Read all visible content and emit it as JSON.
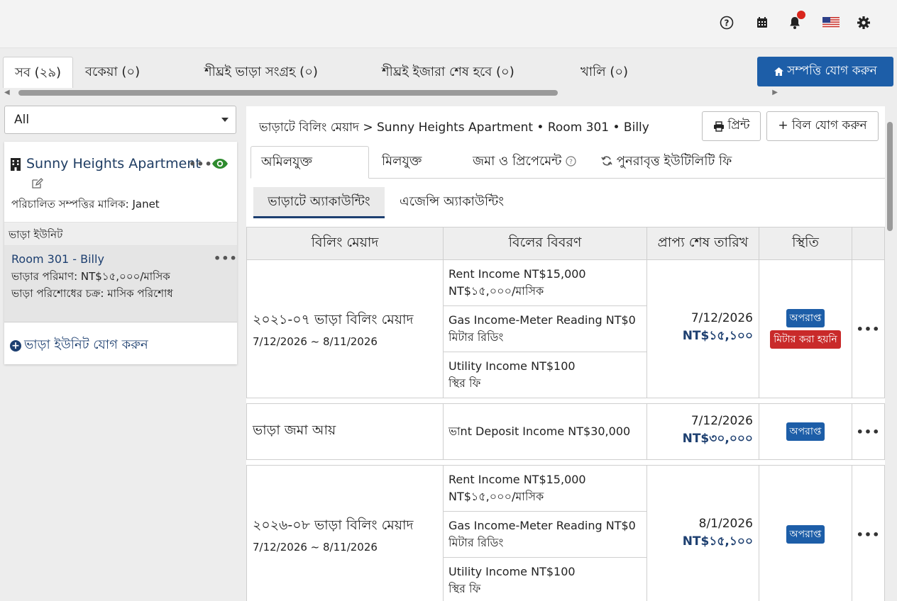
{
  "topbar": {
    "icons": [
      "help-icon",
      "calendar-icon",
      "bell-icon",
      "us-flag-icon",
      "gear-icon"
    ]
  },
  "property_tabs": [
    {
      "label": "সব (২৯)",
      "active": true
    },
    {
      "label": "বকেয়া (০)"
    },
    {
      "label": "শীঘ্রই ভাড়া সংগ্রহ (০)"
    },
    {
      "label": "শীঘ্রই ইজারা শেষ হবে (০)"
    },
    {
      "label": "খালি (০)"
    }
  ],
  "add_property_label": "সম্পত্তি যোগ করুন",
  "filter": {
    "selected": "All"
  },
  "property": {
    "name": "Sunny Heights Apartment",
    "owner": "পরিচালিত সম্পত্তির মালিক: Janet"
  },
  "rental_units_header": "ভাড়া ইউনিট",
  "unit": {
    "name": "Room 301 - Billy",
    "rent": "ভাড়ার পরিমাণ: NT$১৫,০০০/মাসিক",
    "cycle": "ভাড়া পরিশোধের চক্র: মাসিক পরিশোধ"
  },
  "add_unit_label": "ভাড়া ইউনিট যোগ করুন",
  "breadcrumb": {
    "root": "ভাড়াটে বিলিং মেয়াদ",
    "sep": ">",
    "path": "Sunny Heights Apartment • Room 301 • Billy"
  },
  "print_label": "প্রিন্ট",
  "add_bill_label": "+ বিল যোগ করুন",
  "subtabs": [
    {
      "label": "অমিলযুক্ত",
      "active": true
    },
    {
      "label": "মিলযুক্ত"
    },
    {
      "label": "জমা ও প্রিপেমেন্ট"
    },
    {
      "label": "পুনরাবৃত্ত ইউটিলিটি ফি"
    }
  ],
  "accounting_tabs": [
    {
      "label": "ভাড়াটে অ্যাকাউন্টিং",
      "active": true
    },
    {
      "label": "এজেন্সি অ্যাকাউন্টিং"
    }
  ],
  "table": {
    "headers": [
      "বিলিং মেয়াদ",
      "বিলের বিবরণ",
      "প্রাপ্য শেষ তারিখ",
      "স্থিতি",
      ""
    ],
    "groups": [
      {
        "period_title": "২০২১-০৭ ভাড়া বিলিং মেয়াদ",
        "period_dates": "7/12/2026 ~ 8/11/2026",
        "items": [
          {
            "line1": "Rent Income NT$15,000",
            "line2": "NT$১৫,০০০/মাসিক"
          },
          {
            "line1": "Gas Income-Meter Reading NT$0",
            "line2": "মিটার রিডিং"
          },
          {
            "line1": "Utility Income NT$100",
            "line2": "স্থির ফি"
          }
        ],
        "due_date": "7/12/2026",
        "due_amount": "NT$১৫,১০০",
        "badges": [
          {
            "text": "অপরাপ্ত",
            "color": "#1d5ea8"
          },
          {
            "text": "মিটার করা হয়নি",
            "color": "#c92a2a"
          }
        ],
        "menu": "•••"
      },
      {
        "period_title": "ভাড়া জমা আয়",
        "items": [
          {
            "line1": "ভাnt Deposit Income NT$30,000"
          }
        ],
        "due_date": "7/12/2026",
        "due_amount": "NT$৩০,০০০",
        "badges": [
          {
            "text": "অপরাপ্ত",
            "color": "#1d5ea8"
          }
        ],
        "menu": "•••"
      },
      {
        "period_title": "২০২৬-০৮ ভাড়া বিলিং মেয়াদ",
        "period_dates": "7/12/2026 ~ 8/11/2026",
        "items": [
          {
            "line1": "Rent Income NT$15,000",
            "line2": "NT$১৫,০০০/মাসিক"
          },
          {
            "line1": "Gas Income-Meter Reading NT$0",
            "line2": "মিটার রিডিং"
          },
          {
            "line1": "Utility Income NT$100",
            "line2": "স্থির ফি"
          }
        ],
        "due_date": "8/1/2026",
        "due_amount": "NT$১৫,১০০",
        "badges": [
          {
            "text": "অপরাপ্ত",
            "color": "#1d5ea8"
          }
        ],
        "menu": "•••"
      }
    ]
  }
}
